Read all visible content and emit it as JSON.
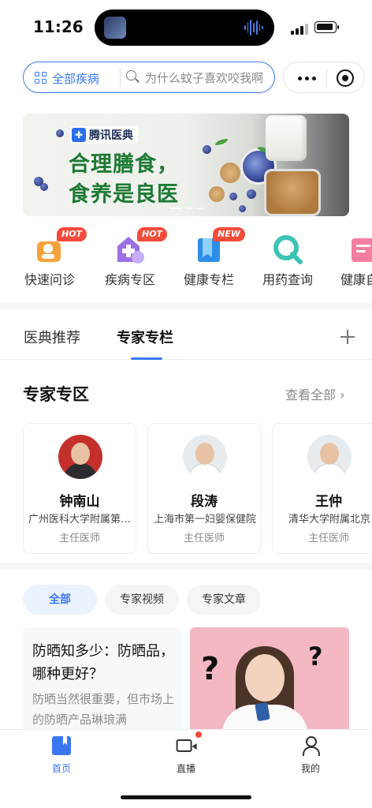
{
  "status_bar": {
    "time": "11:26"
  },
  "search": {
    "category_label": "全部疾病",
    "placeholder": "为什么蚊子喜欢咬我啊"
  },
  "banner": {
    "brand": "腾讯医典",
    "line1": "合理膳食，",
    "line2": "食养是良医"
  },
  "quick_entries": [
    {
      "label": "快速问诊",
      "tag": "HOT",
      "icon": "consult-icon"
    },
    {
      "label": "疾病专区",
      "tag": "HOT",
      "icon": "disease-icon"
    },
    {
      "label": "健康专栏",
      "tag": "NEW",
      "icon": "bookmark-icon"
    },
    {
      "label": "用药查询",
      "tag": "",
      "icon": "drug-search-icon"
    },
    {
      "label": "健康自",
      "tag": "",
      "icon": "health-icon"
    }
  ],
  "tabs": [
    {
      "label": "医典推荐"
    },
    {
      "label": "专家专栏"
    }
  ],
  "experts_section": {
    "title": "专家专区",
    "see_all": "查看全部"
  },
  "experts": [
    {
      "name": "钟南山",
      "org": "广州医科大学附属第一医院",
      "title": "主任医师"
    },
    {
      "name": "段涛",
      "org": "上海市第一妇婴保健院",
      "title": "主任医师"
    },
    {
      "name": "王仲",
      "org": "清华大学附属北京",
      "title": "主任医师"
    }
  ],
  "filters": [
    {
      "label": "全部"
    },
    {
      "label": "专家视频"
    },
    {
      "label": "专家文章"
    }
  ],
  "article": {
    "title": "防晒知多少：防晒品，哪种更好？",
    "summary": "防晒当然很重要，但市场上的防晒产品琳琅满"
  },
  "bottom_nav": [
    {
      "label": "首页",
      "icon": "home-icon"
    },
    {
      "label": "直播",
      "icon": "live-icon"
    },
    {
      "label": "我的",
      "icon": "profile-icon"
    }
  ],
  "colors": {
    "accent": "#3a78f2",
    "banner_green": "#1e7a34",
    "tag_red": "#f44b3a"
  }
}
